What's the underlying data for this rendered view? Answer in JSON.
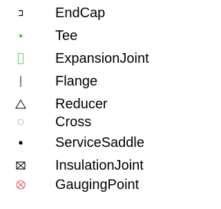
{
  "legend": {
    "items": [
      {
        "label": "EndCap",
        "icon": "endcap-icon",
        "glyph": "ᄀ",
        "color": "#000000"
      },
      {
        "label": "Tee",
        "icon": "tee-icon",
        "glyph": "•",
        "color": "#22cc22"
      },
      {
        "label": "ExpansionJoint",
        "icon": "expansion-joint-icon",
        "glyph": "▯",
        "color": "#66cc77"
      },
      {
        "label": "Flange",
        "icon": "flange-icon",
        "glyph": "|",
        "color": "#000000"
      },
      {
        "label": "Reducer",
        "icon": "reducer-icon",
        "glyph": "△",
        "color": "#000000"
      },
      {
        "label": "Cross",
        "icon": "cross-icon",
        "glyph": "○",
        "color": "#bbbbbb"
      },
      {
        "label": "ServiceSaddle",
        "icon": "service-saddle-icon",
        "glyph": "•",
        "color": "#000000"
      },
      {
        "label": "InsulationJoint",
        "icon": "insulation-joint-icon",
        "glyph": "⊠",
        "color": "#000000"
      },
      {
        "label": "GaugingPoint",
        "icon": "gauging-point-icon",
        "glyph": "⊗",
        "color": "#ee4444"
      }
    ]
  }
}
